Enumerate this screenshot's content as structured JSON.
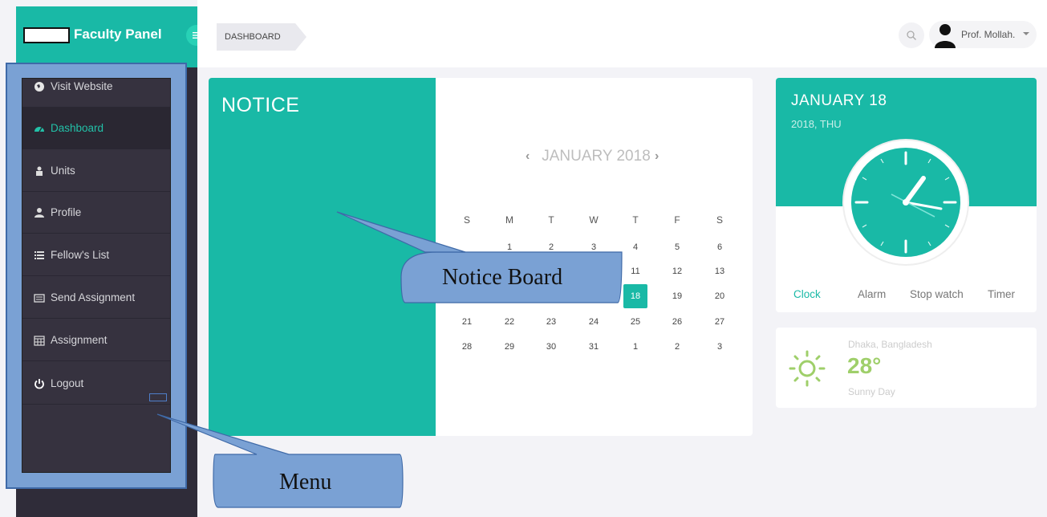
{
  "brand": {
    "title": "Faculty Panel"
  },
  "header": {
    "breadcrumb": "DASHBOARD",
    "user_name": "Prof. Mollah."
  },
  "sidebar": {
    "items": [
      {
        "label": "Visit Website",
        "icon": "globe-icon"
      },
      {
        "label": "Dashboard",
        "icon": "dashboard-icon",
        "active": true
      },
      {
        "label": "Units",
        "icon": "units-icon"
      },
      {
        "label": "Profile",
        "icon": "user-icon"
      },
      {
        "label": "Fellow's List",
        "icon": "list-icon"
      },
      {
        "label": "Send Assignment",
        "icon": "envelope-icon"
      },
      {
        "label": "Assignment",
        "icon": "calendar-icon"
      },
      {
        "label": "Logout",
        "icon": "power-icon"
      }
    ]
  },
  "notice": {
    "title": "NOTICE"
  },
  "calendar": {
    "month_label": "JANUARY 2018",
    "weekdays": [
      "S",
      "M",
      "T",
      "W",
      "T",
      "F",
      "S"
    ],
    "weeks": [
      [
        "",
        "1",
        "2",
        "3",
        "4",
        "5",
        "6"
      ],
      [
        "",
        "",
        "",
        "",
        "11",
        "12",
        "13"
      ],
      [
        "",
        "",
        "",
        "",
        "18",
        "19",
        "20"
      ],
      [
        "21",
        "22",
        "23",
        "24",
        "25",
        "26",
        "27"
      ],
      [
        "28",
        "29",
        "30",
        "31",
        "1",
        "2",
        "3"
      ]
    ],
    "today": "18"
  },
  "clock": {
    "date": "JANUARY 18",
    "sub": "2018, THU",
    "tabs": [
      "Clock",
      "Alarm",
      "Stop watch",
      "Timer"
    ]
  },
  "weather": {
    "location": "Dhaka, Bangladesh",
    "temperature": "28°",
    "description": "Sunny Day"
  },
  "annotations": {
    "notice_board": "Notice Board",
    "menu": "Menu"
  },
  "colors": {
    "accent": "#19b9a6",
    "sidebar": "#2f2c39",
    "callout_fill": "#7aa1d4"
  }
}
